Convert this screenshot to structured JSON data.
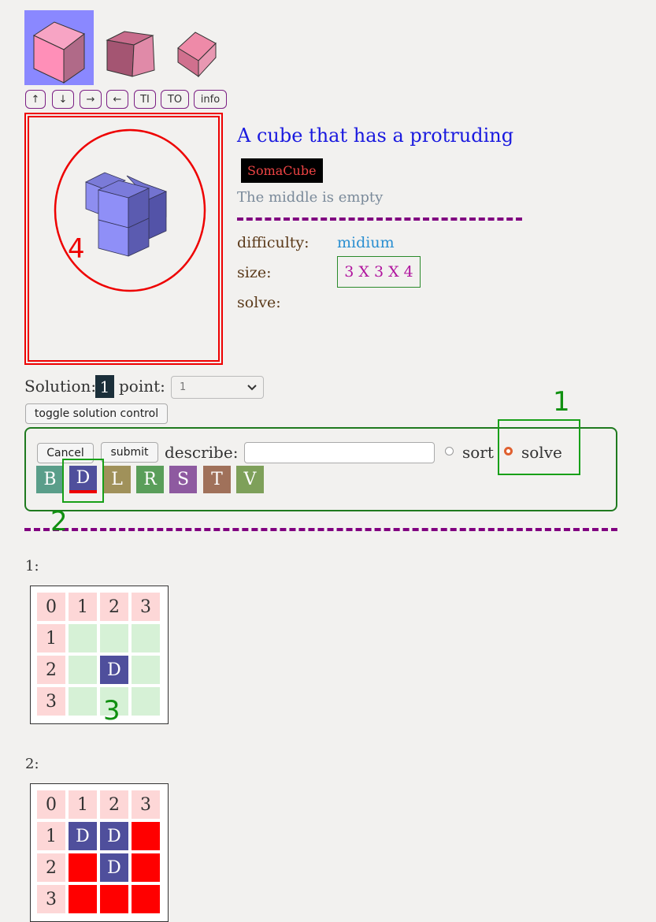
{
  "thumbnails": [
    {
      "name": "cube-thumbnail-1",
      "selected": true
    },
    {
      "name": "cube-thumbnail-2",
      "selected": false
    },
    {
      "name": "cube-thumbnail-3",
      "selected": false
    }
  ],
  "nav_buttons": [
    "↑",
    "↓",
    "→",
    "←",
    "TI",
    "TO",
    "info"
  ],
  "puzzle": {
    "title": "A cube that has a protruding",
    "badge": "SomaCube",
    "subtitle": "The middle is empty",
    "difficulty_label": "difficulty:",
    "difficulty_value": "midium",
    "size_label": "size:",
    "size_value": "3 X 3 X 4",
    "solve_label": "solve:"
  },
  "solution": {
    "label": "Solution:",
    "number": "1",
    "point_label": "point:",
    "point_value": "1"
  },
  "toggle_button": "toggle solution control",
  "controls": {
    "cancel": "Cancel",
    "submit": "submit",
    "describe_label": "describe:",
    "describe_value": "",
    "sort_label": "sort",
    "solve_label": "solve",
    "mode_selected": "solve",
    "pieces": [
      {
        "letter": "B",
        "color": "#5a9e8a"
      },
      {
        "letter": "D",
        "color": "#4f4f9c",
        "selected": true
      },
      {
        "letter": "L",
        "color": "#a0915a"
      },
      {
        "letter": "R",
        "color": "#5a9e5a"
      },
      {
        "letter": "S",
        "color": "#8e5aa0"
      },
      {
        "letter": "T",
        "color": "#a0715a"
      },
      {
        "letter": "V",
        "color": "#7ea05a"
      }
    ]
  },
  "layers": [
    {
      "label": "1:",
      "rows": [
        [
          "0",
          "1",
          "2",
          "3"
        ],
        [
          "1",
          "",
          "",
          ""
        ],
        [
          "2",
          "",
          "D",
          ""
        ],
        [
          "3",
          "",
          "",
          ""
        ]
      ]
    },
    {
      "label": "2:",
      "rows": [
        [
          "0",
          "1",
          "2",
          "3"
        ],
        [
          "1",
          "D",
          "D",
          "#red"
        ],
        [
          "2",
          "#red",
          "D",
          "#red"
        ],
        [
          "3",
          "#red",
          "#red",
          "#red"
        ]
      ]
    }
  ],
  "annotations": {
    "a1": "1",
    "a2": "2",
    "a3": "3",
    "a4": "4"
  }
}
